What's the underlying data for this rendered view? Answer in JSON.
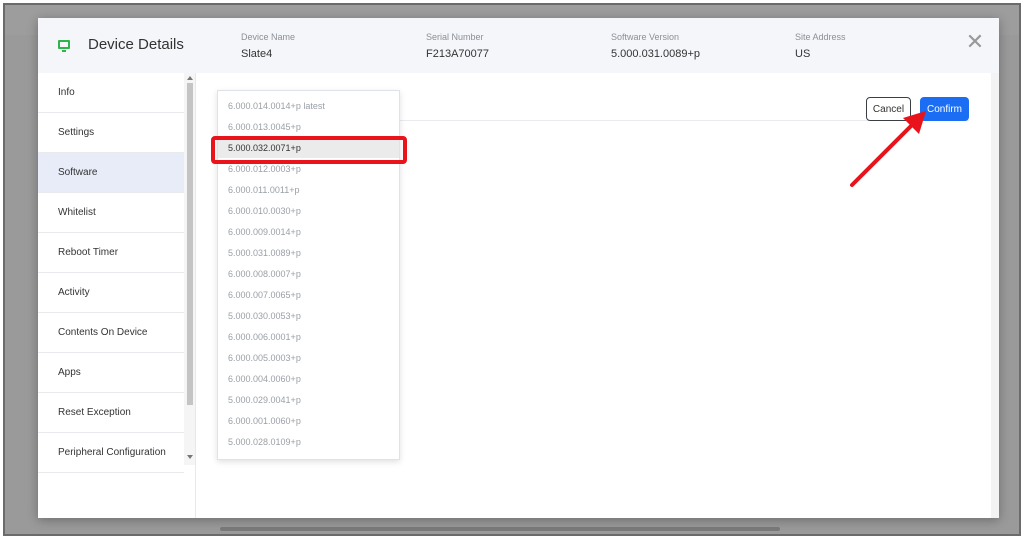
{
  "modal": {
    "title": "Device Details",
    "header_fields": [
      {
        "label": "Device Name",
        "value": "Slate4"
      },
      {
        "label": "Serial Number",
        "value": "F213A70077"
      },
      {
        "label": "Software Version",
        "value": "5.000.031.0089+p"
      },
      {
        "label": "Site Address",
        "value": "US"
      }
    ],
    "close_label": "✕"
  },
  "sidebar": {
    "items": [
      {
        "label": "Info"
      },
      {
        "label": "Settings"
      },
      {
        "label": "Software"
      },
      {
        "label": "Whitelist"
      },
      {
        "label": "Reboot Timer"
      },
      {
        "label": "Activity"
      },
      {
        "label": "Contents On Device"
      },
      {
        "label": "Apps"
      },
      {
        "label": "Reset Exception"
      },
      {
        "label": "Peripheral Configuration"
      }
    ],
    "active_index": 2
  },
  "actions": {
    "cancel_label": "Cancel",
    "confirm_label": "Confirm"
  },
  "dropdown": {
    "options": [
      "6.000.014.0014+p latest",
      "6.000.013.0045+p",
      "5.000.032.0071+p",
      "6.000.012.0003+p",
      "6.000.011.0011+p",
      "6.000.010.0030+p",
      "6.000.009.0014+p",
      "5.000.031.0089+p",
      "6.000.008.0007+p",
      "6.000.007.0065+p",
      "5.000.030.0053+p",
      "6.000.006.0001+p",
      "6.000.005.0003+p",
      "6.000.004.0060+p",
      "5.000.029.0041+p",
      "6.000.001.0060+p",
      "5.000.028.0109+p"
    ],
    "selected_index": 2
  },
  "colors": {
    "accent": "#1b6ef3",
    "annotation": "#e8131b",
    "device_icon": "#2fb44b"
  }
}
